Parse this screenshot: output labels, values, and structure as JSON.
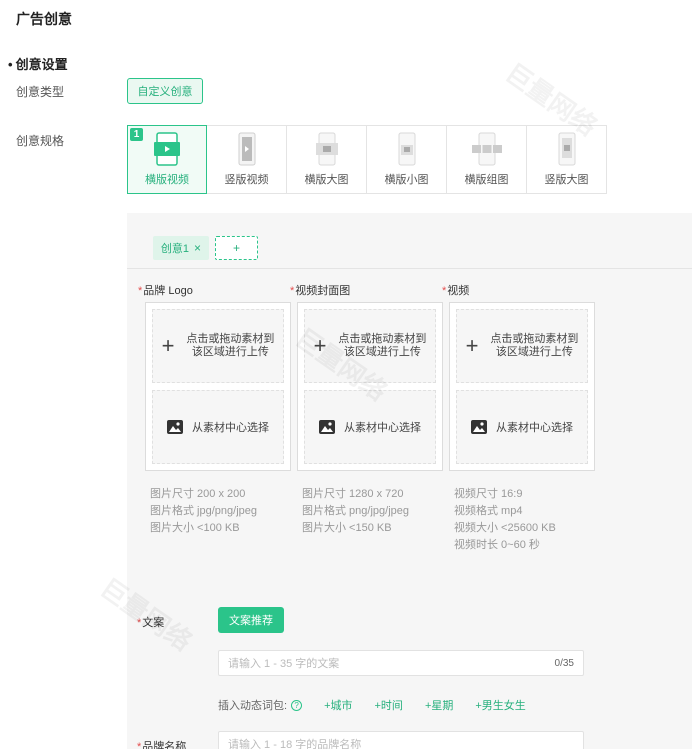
{
  "page": {
    "title": "广告创意",
    "section_title": "创意设置"
  },
  "creative_type": {
    "label": "创意类型",
    "button": "自定义创意"
  },
  "creative_spec": {
    "label": "创意规格",
    "selected_index_badge": "1",
    "options": [
      "横版视频",
      "竖版视频",
      "横版大图",
      "横版小图",
      "横版组图",
      "竖版大图"
    ]
  },
  "tabs": {
    "creative_tab": "创意1",
    "add_label": "+"
  },
  "uploads": [
    {
      "label": "品牌 Logo",
      "upload_text_1": "点击或拖动素材到",
      "upload_text_2": "该区域进行上传",
      "pick_text": "从素材中心选择",
      "specs": [
        "图片尺寸 200 x 200",
        "图片格式 jpg/png/jpeg",
        "图片大小 <100 KB"
      ]
    },
    {
      "label": "视频封面图",
      "upload_text_1": "点击或拖动素材到",
      "upload_text_2": "该区域进行上传",
      "pick_text": "从素材中心选择",
      "specs": [
        "图片尺寸 1280 x 720",
        "图片格式 png/jpg/jpeg",
        "图片大小 <150 KB"
      ]
    },
    {
      "label": "视频",
      "upload_text_1": "点击或拖动素材到",
      "upload_text_2": "该区域进行上传",
      "pick_text": "从素材中心选择",
      "specs": [
        "视频尺寸 16:9",
        "视频格式 mp4",
        "视频大小 <25600 KB",
        "视频时长 0~60 秒"
      ]
    }
  ],
  "copy": {
    "label": "文案",
    "recommend_button": "文案推荐",
    "placeholder": "请输入 1 - 35 字的文案",
    "counter": "0/35"
  },
  "dynamic_words": {
    "label": "插入动态词包:",
    "help": "?",
    "tags": [
      "+城市",
      "+时间",
      "+星期",
      "+男生女生"
    ]
  },
  "brand_name": {
    "label": "品牌名称",
    "placeholder": "请输入 1 - 18 字的品牌名称"
  },
  "watermark": "巨量网络",
  "colors": {
    "accent": "#2bc48a",
    "required": "#e34d4d"
  }
}
